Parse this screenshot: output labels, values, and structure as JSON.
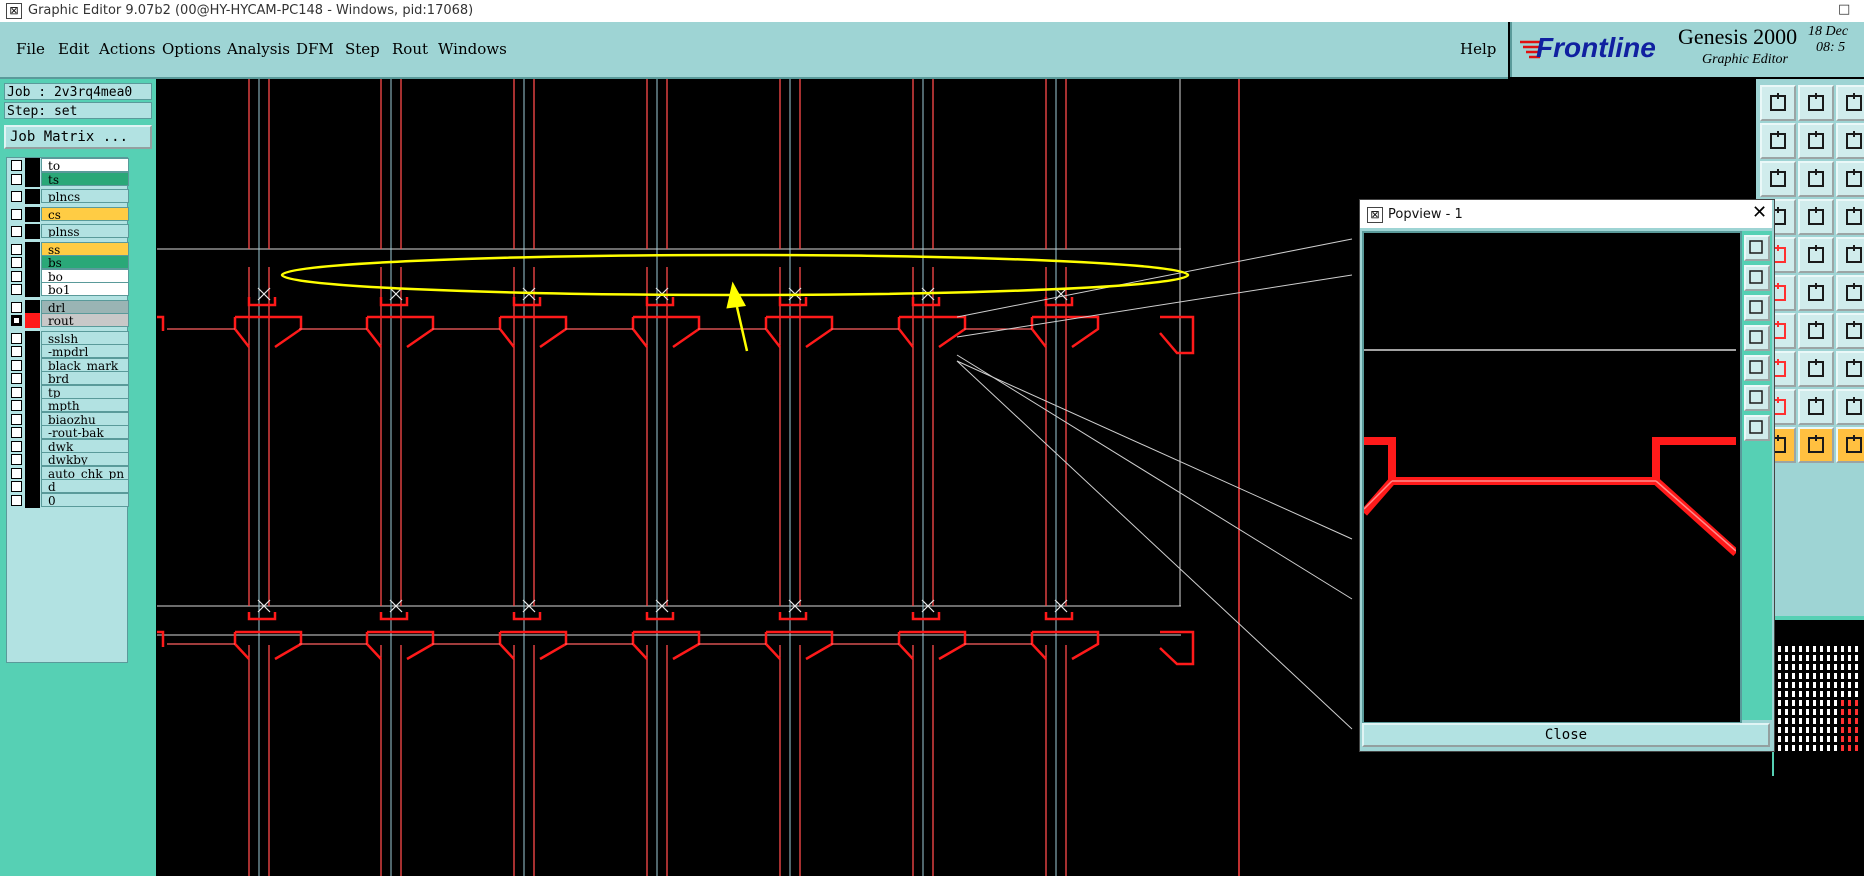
{
  "window": {
    "title": "Graphic Editor 9.07b2 (00@HY-HYCAM-PC148 - Windows, pid:17068)",
    "minimize_glyph": "□"
  },
  "menu": {
    "file": "File",
    "edit": "Edit",
    "actions": "Actions",
    "options": "Options",
    "analysis": "Analysis",
    "dfm": "DFM",
    "step": "Step",
    "rout": "Rout",
    "windows": "Windows",
    "help": "Help"
  },
  "brand": {
    "logo": "Frontline",
    "product": "Genesis 2000",
    "subtitle": "Graphic Editor",
    "date": "18 Dec",
    "time": "08: 5"
  },
  "job": {
    "job_line": "Job : 2v3rq4mea0",
    "step_line": "Step: set",
    "matrix_button": "Job Matrix ..."
  },
  "layers": [
    {
      "name": "to",
      "bg": "#ffffff",
      "checked": false,
      "color": "#000000"
    },
    {
      "name": "ts",
      "bg": "#2aa878",
      "checked": false,
      "color": "#000000"
    },
    {
      "name": "plncs",
      "bg": "#b2e2e2",
      "checked": false,
      "color": "#000000"
    },
    {
      "name": "cs",
      "bg": "#ffcc44",
      "checked": false,
      "color": "#000000"
    },
    {
      "name": "plnss",
      "bg": "#b2e2e2",
      "checked": false,
      "color": "#000000"
    },
    {
      "name": "ss",
      "bg": "#ffcc44",
      "checked": false,
      "color": "#000000"
    },
    {
      "name": "bs",
      "bg": "#2aa878",
      "checked": false,
      "color": "#000000"
    },
    {
      "name": "bo",
      "bg": "#ffffff",
      "checked": false,
      "color": "#000000"
    },
    {
      "name": "bo1",
      "bg": "#ffffff",
      "checked": false,
      "color": "#000000"
    },
    {
      "name": "drl",
      "bg": "#9ab4b4",
      "checked": false,
      "color": "#000000"
    },
    {
      "name": "rout",
      "bg": "#c8c8c8",
      "checked": true,
      "color": "#ff1a1a"
    },
    {
      "name": "sslsh",
      "bg": "#b2e2e2",
      "checked": false,
      "color": "#000000"
    },
    {
      "name": "-mpdrl",
      "bg": "#b2e2e2",
      "checked": false,
      "color": "#000000"
    },
    {
      "name": "black_mark",
      "bg": "#b2e2e2",
      "checked": false,
      "color": "#000000"
    },
    {
      "name": "brd",
      "bg": "#b2e2e2",
      "checked": false,
      "color": "#000000"
    },
    {
      "name": "tp",
      "bg": "#b2e2e2",
      "checked": false,
      "color": "#000000"
    },
    {
      "name": "mpth",
      "bg": "#b2e2e2",
      "checked": false,
      "color": "#000000"
    },
    {
      "name": "biaozhu",
      "bg": "#b2e2e2",
      "checked": false,
      "color": "#000000"
    },
    {
      "name": "-rout-bak",
      "bg": "#b2e2e2",
      "checked": false,
      "color": "#000000"
    },
    {
      "name": "dwk",
      "bg": "#b2e2e2",
      "checked": false,
      "color": "#000000"
    },
    {
      "name": "dwkby",
      "bg": "#b2e2e2",
      "checked": false,
      "color": "#000000"
    },
    {
      "name": "auto_chk_pn",
      "bg": "#b2e2e2",
      "checked": false,
      "color": "#000000"
    },
    {
      "name": "d",
      "bg": "#b2e2e2",
      "checked": false,
      "color": "#000000"
    },
    {
      "name": "0",
      "bg": "#b2e2e2",
      "checked": false,
      "color": "#000000"
    }
  ],
  "popview": {
    "title": "Popview - 1",
    "close_x": "✕",
    "close_button": "Close"
  },
  "colors": {
    "rout": "#ff1a1a",
    "highlight": "#ffff00",
    "panel": "#9ed4d4"
  }
}
